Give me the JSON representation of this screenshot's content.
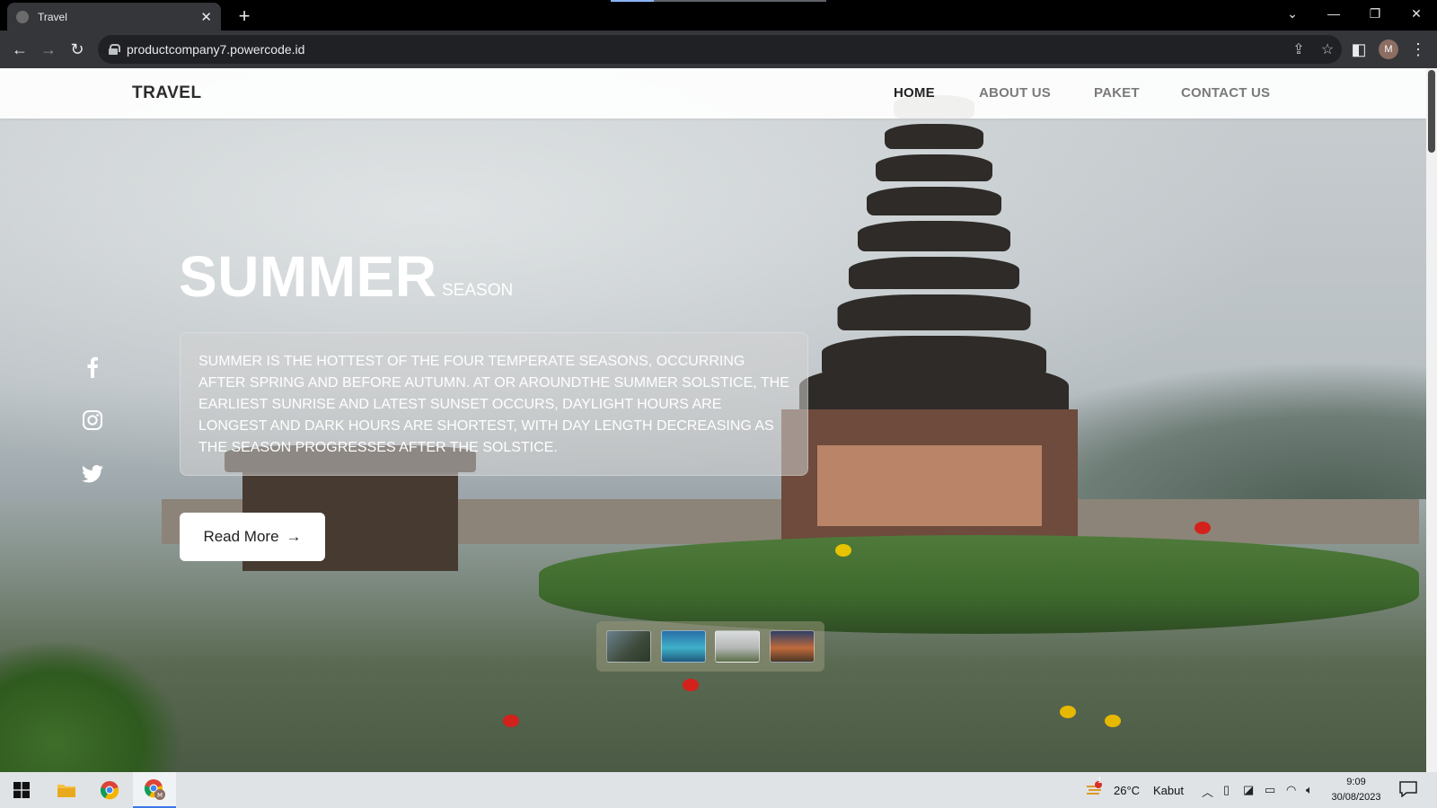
{
  "browser": {
    "tab_title": "Travel",
    "new_tab_symbol": "+",
    "url": "productcompany7.powercode.id",
    "profile_initial": "M"
  },
  "site": {
    "brand": "TRAVEL",
    "nav": [
      {
        "label": "HOME",
        "active": true
      },
      {
        "label": "ABOUT US",
        "active": false
      },
      {
        "label": "PAKET",
        "active": false
      },
      {
        "label": "CONTACT US",
        "active": false
      }
    ]
  },
  "hero": {
    "title": "SUMMER",
    "subtitle": "SEASON",
    "description": "SUMMER IS THE HOTTEST OF THE FOUR TEMPERATE SEASONS, OCCURRING AFTER SPRING AND BEFORE AUTUMN. AT OR AROUNDTHE SUMMER SOLSTICE, THE EARLIEST SUNRISE AND LATEST SUNSET OCCURS, DAYLIGHT HOURS ARE LONGEST AND DARK HOURS ARE SHORTEST, WITH DAY LENGTH DECREASING AS THE SEASON PROGRESSES AFTER THE SOLSTICE.",
    "cta": "Read More"
  },
  "social_icons": [
    "facebook-icon",
    "instagram-icon",
    "twitter-icon"
  ],
  "thumbnails": [
    "mountain-cliff",
    "blue-lagoon",
    "temple",
    "sunset-woman"
  ],
  "taskbar": {
    "weather": "26°C",
    "weather_desc": "Kabut",
    "weather_badge": "1",
    "time": "9:09",
    "date": "30/08/2023"
  }
}
